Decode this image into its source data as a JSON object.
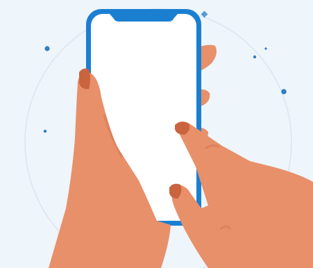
{
  "illustration": {
    "subject": "hands-holding-smartphone",
    "colors": {
      "background": "#eef5fb",
      "phone_frame": "#1b7fd1",
      "screen": "#ffffff",
      "skin": "#e8906a",
      "skin_shade": "#cf744f",
      "nail": "#c9643f",
      "orbit": "#dbe6f0",
      "dot": "#2f7fc2"
    }
  }
}
